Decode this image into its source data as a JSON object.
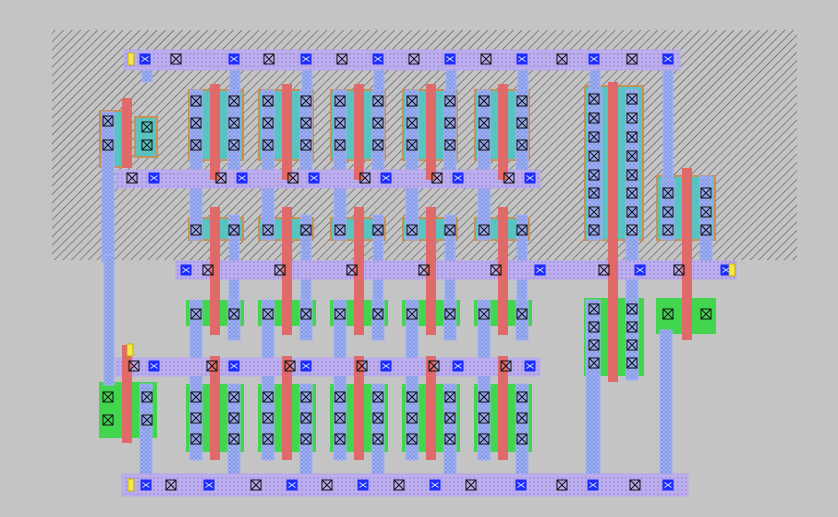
{
  "canvas": {
    "background": "#c4c4c4"
  },
  "legend": {
    "nwell_hatch": "#555555",
    "poly": "#e06a6a",
    "metal1": "#9fb2f2",
    "metal2": "#b7a8ea",
    "active": "#58c3c0",
    "implant": "#42d64f",
    "contact": "#1c2cff",
    "via": "#111111",
    "pin": "#f7e84a"
  },
  "icons": {
    "contact": "contact-icon",
    "via": "via-icon",
    "pin": "pin-icon"
  }
}
